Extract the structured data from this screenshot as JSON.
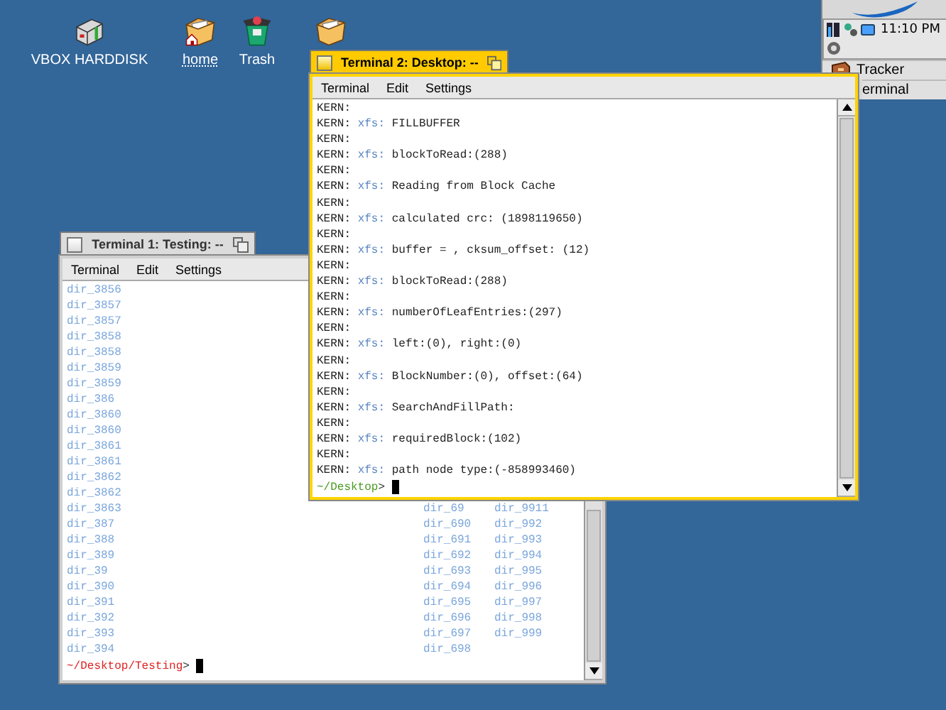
{
  "desktop_icons": [
    {
      "kind": "disk",
      "label": "VBOX HARDDISK",
      "link": false
    },
    {
      "kind": "home",
      "label": "home",
      "link": true
    },
    {
      "kind": "trash",
      "label": "Trash",
      "link": false
    },
    {
      "kind": "folder"
    }
  ],
  "deskbar": {
    "clock": "11:10 PM",
    "apps": [
      {
        "kind": "tracker",
        "label": "Tracker"
      },
      {
        "kind": "terminal",
        "label": "erminal"
      }
    ]
  },
  "windows": [
    {
      "kind": "listing",
      "title": "Terminal 1: Testing: --",
      "active": false,
      "menu": [
        "Terminal",
        "Edit",
        "Settings"
      ],
      "rows": [
        {
          "column_1": "dir_3856"
        },
        {
          "column_1": "dir_3857"
        },
        {
          "column_1": "dir_3857"
        },
        {
          "column_1": "dir_3858"
        },
        {
          "column_1": "dir_3858"
        },
        {
          "column_1": "dir_3859"
        },
        {
          "column_1": "dir_3859"
        },
        {
          "column_1": "dir_386"
        },
        {
          "column_1": "dir_3860"
        },
        {
          "column_1": "dir_3860"
        },
        {
          "column_1": "dir_3861"
        },
        {
          "column_1": "dir_3861"
        },
        {
          "column_1": "dir_3862"
        },
        {
          "column_1": "dir_3862"
        },
        {
          "column_1": "dir_3863",
          "column_3": "dir_69",
          "column_4": "dir_9911"
        },
        {
          "column_1": "dir_387",
          "column_3": "dir_690",
          "column_4": "dir_992"
        },
        {
          "column_1": "dir_388",
          "column_3": "dir_691",
          "column_4": "dir_993"
        },
        {
          "column_1": "dir_389",
          "column_3": "dir_692",
          "column_4": "dir_994"
        },
        {
          "column_1": "dir_39",
          "column_3": "dir_693",
          "column_4": "dir_995"
        },
        {
          "column_1": "dir_390",
          "column_3": "dir_694",
          "column_4": "dir_996"
        },
        {
          "column_1": "dir_391",
          "column_3": "dir_695",
          "column_4": "dir_997"
        },
        {
          "column_1": "dir_392",
          "column_3": "dir_696",
          "column_4": "dir_998"
        },
        {
          "column_1": "dir_393",
          "column_3": "dir_697",
          "column_4": "dir_999"
        },
        {
          "column_1": "dir_394",
          "column_3": "dir_698"
        }
      ],
      "prompt": {
        "path": "~/Desktop/Testing",
        "symbol": ">",
        "color": "#e02020"
      }
    },
    {
      "kind": "log",
      "title": "Terminal 2: Desktop: --",
      "active": true,
      "menu": [
        "Terminal",
        "Edit",
        "Settings"
      ],
      "lines": [
        {
          "source": "KERN:"
        },
        {
          "source": "KERN:",
          "tag": "xfs:",
          "message": "FILLBUFFER"
        },
        {
          "source": "KERN:"
        },
        {
          "source": "KERN:",
          "tag": "xfs:",
          "message": "blockToRead:(288)"
        },
        {
          "source": "KERN:"
        },
        {
          "source": "KERN:",
          "tag": "xfs:",
          "message": "Reading from Block Cache"
        },
        {
          "source": "KERN:"
        },
        {
          "source": "KERN:",
          "tag": "xfs:",
          "message": "calculated crc: (1898119650)"
        },
        {
          "source": "KERN:"
        },
        {
          "source": "KERN:",
          "tag": "xfs:",
          "message": "buffer = , cksum_offset: (12)"
        },
        {
          "source": "KERN:"
        },
        {
          "source": "KERN:",
          "tag": "xfs:",
          "message": "blockToRead:(288)"
        },
        {
          "source": "KERN:"
        },
        {
          "source": "KERN:",
          "tag": "xfs:",
          "message": "numberOfLeafEntries:(297)"
        },
        {
          "source": "KERN:"
        },
        {
          "source": "KERN:",
          "tag": "xfs:",
          "message": "left:(0), right:(0)"
        },
        {
          "source": "KERN:"
        },
        {
          "source": "KERN:",
          "tag": "xfs:",
          "message": "BlockNumber:(0), offset:(64)"
        },
        {
          "source": "KERN:"
        },
        {
          "source": "KERN:",
          "tag": "xfs:",
          "message": "SearchAndFillPath:"
        },
        {
          "source": "KERN:"
        },
        {
          "source": "KERN:",
          "tag": "xfs:",
          "message": "requiredBlock:(102)"
        },
        {
          "source": "KERN:"
        },
        {
          "source": "KERN:",
          "tag": "xfs:",
          "message": "path node type:(-858993460)"
        }
      ],
      "prompt": {
        "path": "~/Desktop",
        "symbol": ">",
        "color": "#4a9a20"
      }
    }
  ]
}
